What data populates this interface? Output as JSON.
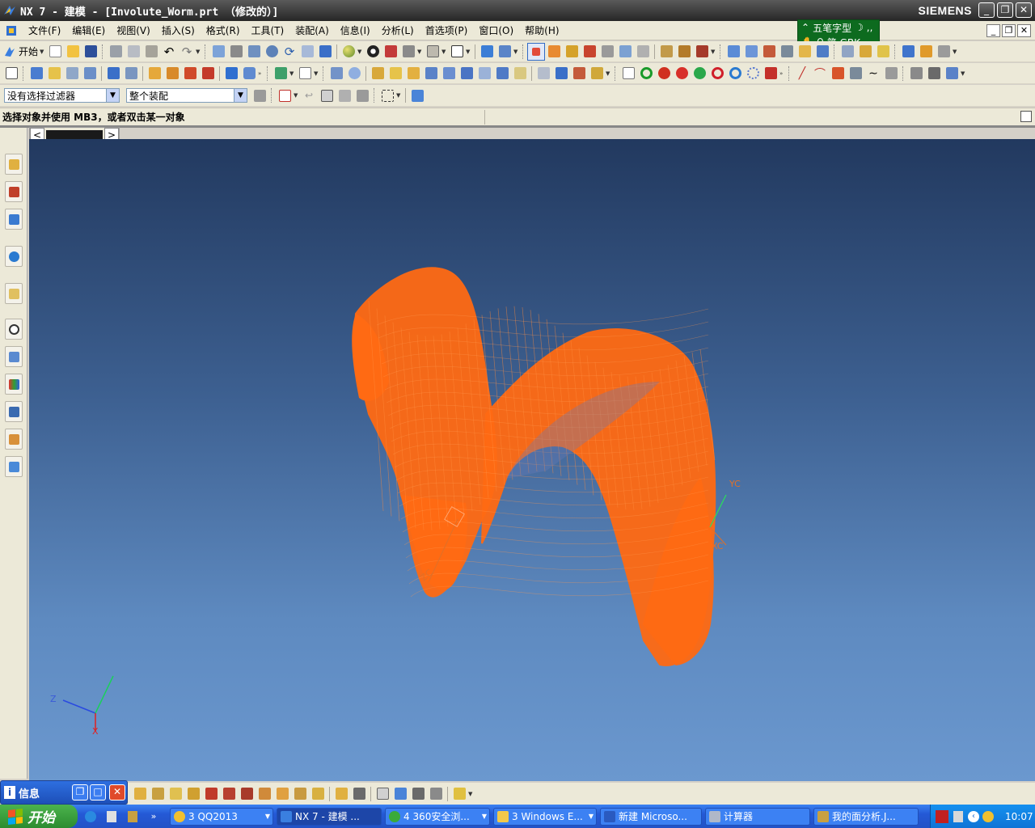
{
  "window": {
    "title": "NX 7 - 建模 - [Involute_Worm.prt （修改的）]",
    "brand": "SIEMENS",
    "controls": [
      "_",
      "❐",
      "✕"
    ]
  },
  "menubar": {
    "items": [
      "文件(F)",
      "编辑(E)",
      "视图(V)",
      "插入(S)",
      "格式(R)",
      "工具(T)",
      "装配(A)",
      "信息(I)",
      "分析(L)",
      "首选项(P)",
      "窗口(O)",
      "帮助(H)"
    ]
  },
  "ime": {
    "row1": "五笔字型",
    "row2": "简 GBK"
  },
  "toolbar1": {
    "start_label": "开始"
  },
  "selection_bar": {
    "filter_value": "没有选择过滤器",
    "scope_value": "整个装配"
  },
  "cue_line": {
    "text": "选择对象并使用 MB3，或者双击某一对象"
  },
  "graphics": {
    "labels": {
      "yc": "YC",
      "xc": "XC",
      "zc": "ZC",
      "triad_z": "Z",
      "triad_x": "X"
    },
    "colors": {
      "model": "#ff6a13",
      "background_top": "#22395f",
      "background_bottom": "#6b98cf"
    }
  },
  "info_panel": {
    "label": "信息"
  },
  "taskbar": {
    "start_label": "开始",
    "tasks": [
      {
        "label": "3 QQ2013",
        "icon": "qq-icon"
      },
      {
        "label": "NX 7 - 建模 ...",
        "icon": "nx-icon"
      },
      {
        "label": "4 360安全浏...",
        "icon": "browser-icon"
      },
      {
        "label": "3 Windows E...",
        "icon": "folder-icon"
      },
      {
        "label": "新建 Microso...",
        "icon": "word-icon"
      },
      {
        "label": "计算器",
        "icon": "calculator-icon"
      },
      {
        "label": "我的面分析.J...",
        "icon": "file-icon"
      }
    ],
    "clock": "10:07"
  }
}
